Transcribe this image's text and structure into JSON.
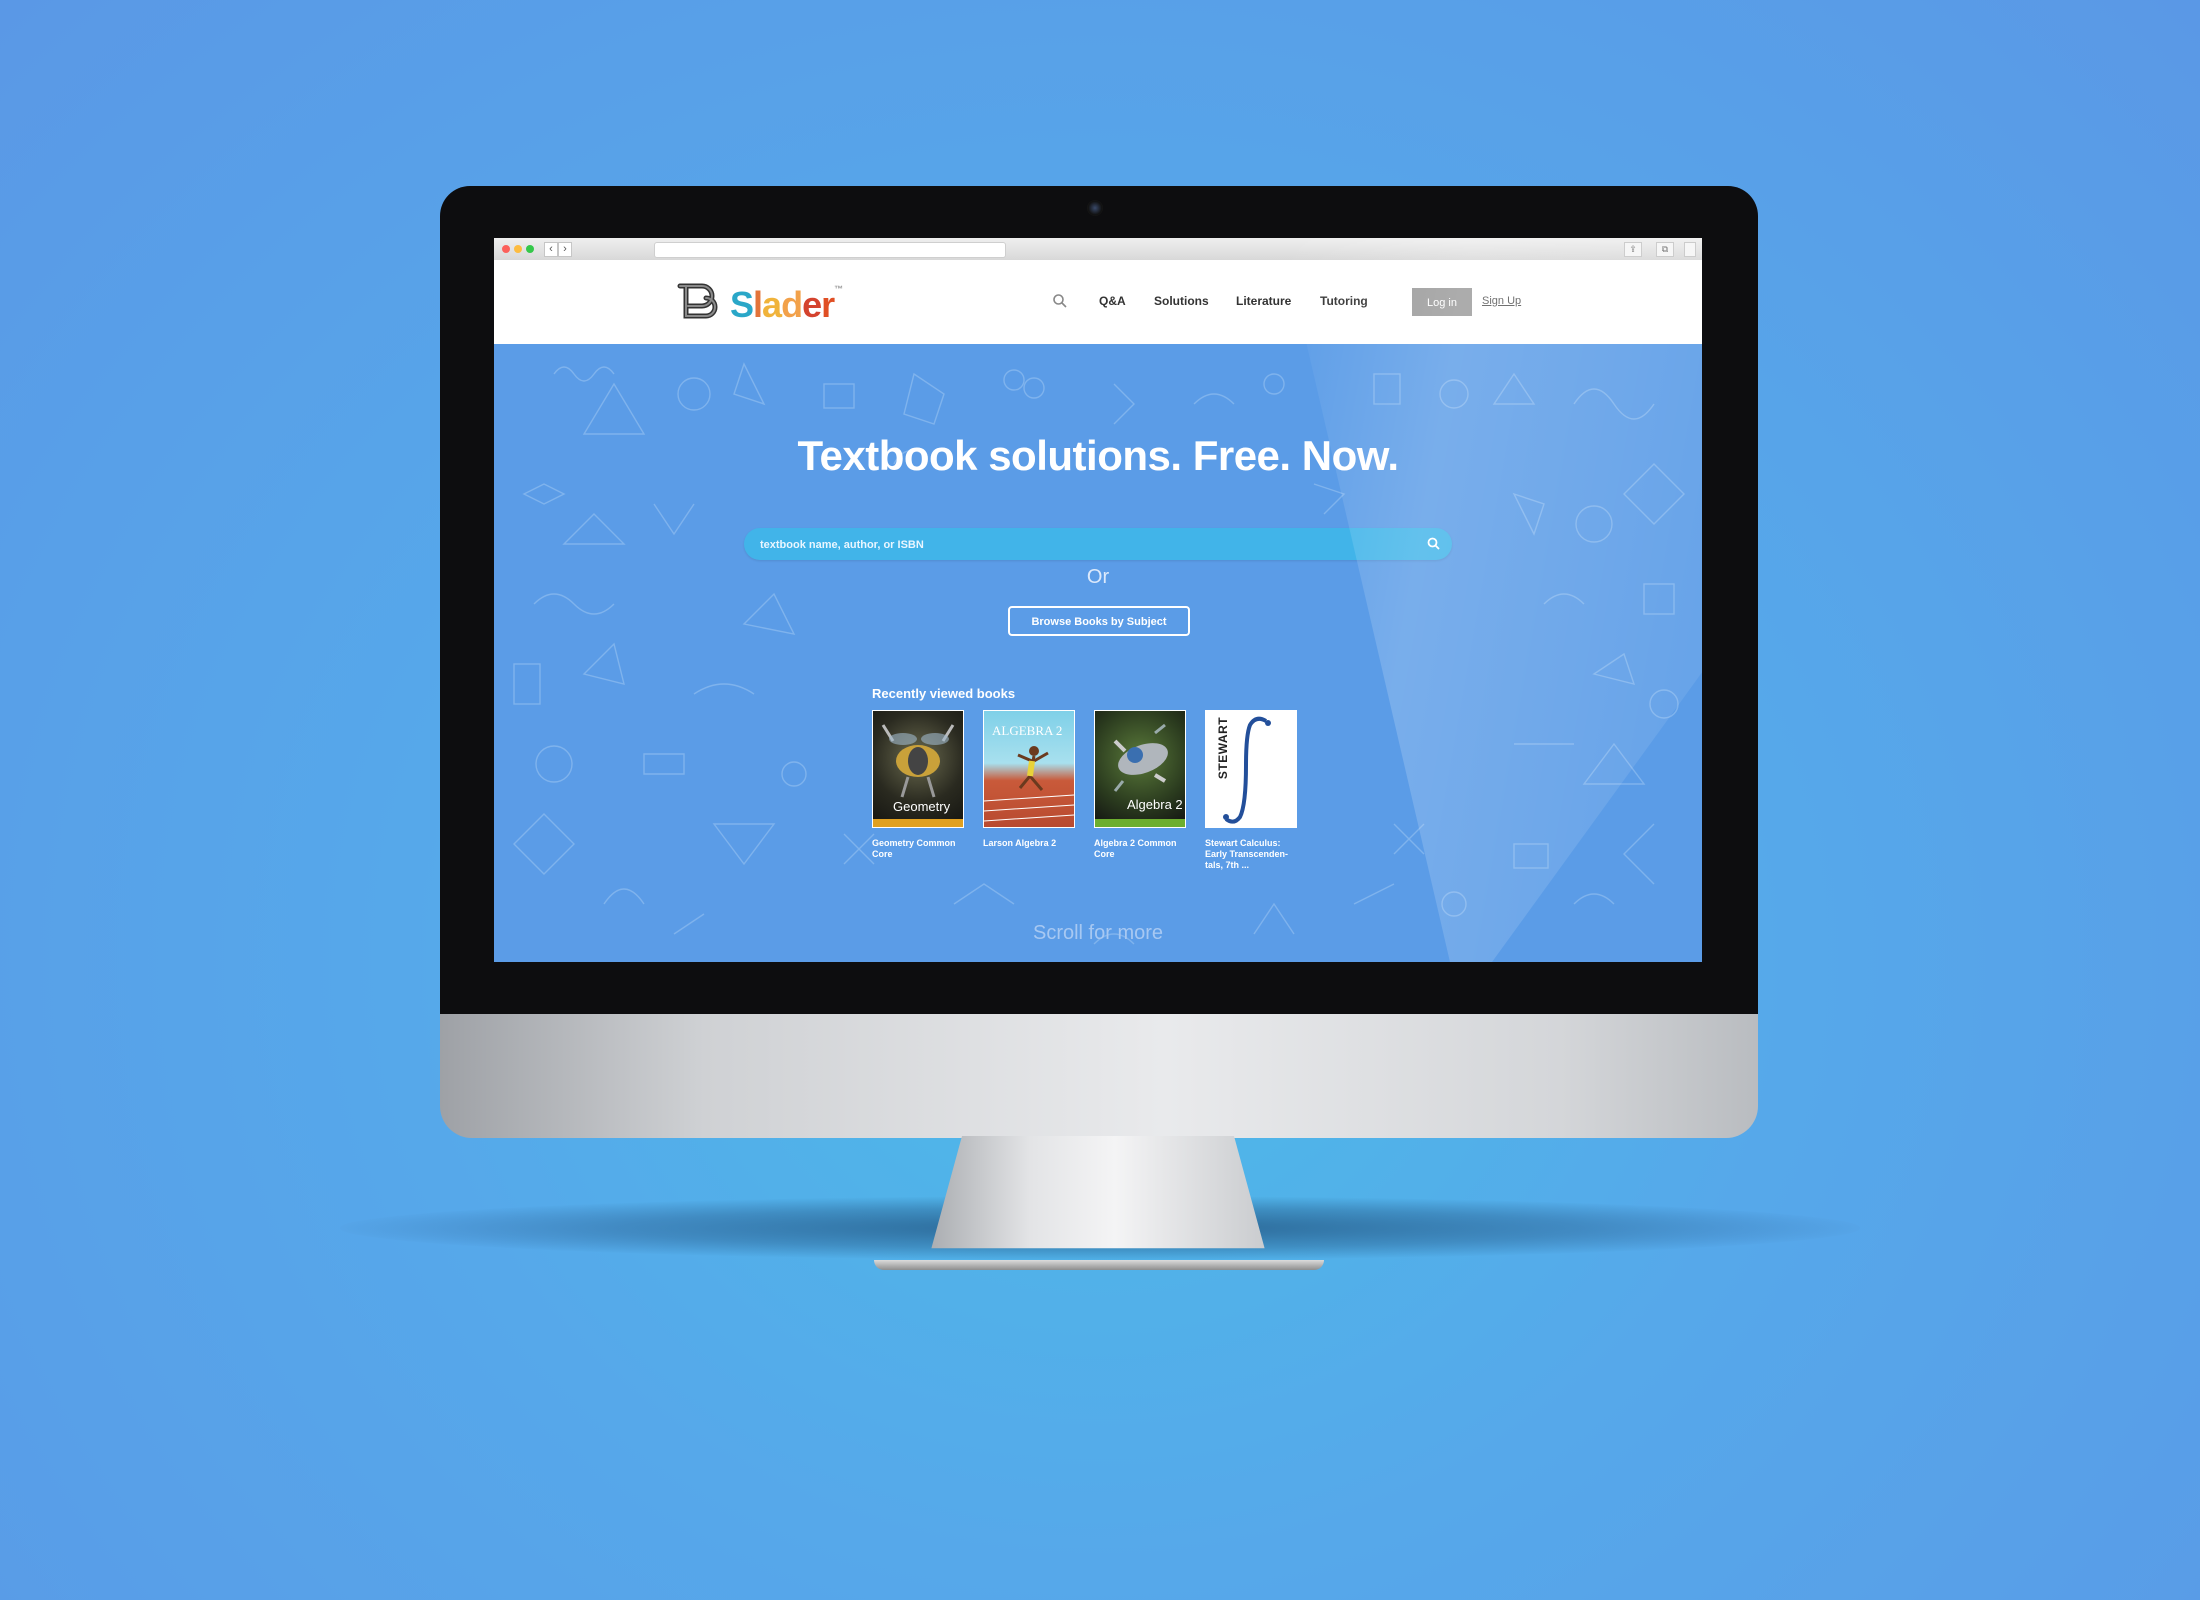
{
  "browser": {
    "back": "‹",
    "forward": "›"
  },
  "header": {
    "logo_text": "Slader",
    "nav": [
      "Q&A",
      "Solutions",
      "Literature",
      "Tutoring"
    ],
    "login_label": "Log in",
    "signup_label": "Sign Up"
  },
  "hero": {
    "title": "Textbook solutions. Free. Now.",
    "search_placeholder": "textbook name, author, or ISBN",
    "or_text": "Or",
    "browse_label": "Browse Books by Subject",
    "recent_title": "Recently viewed books",
    "scroll_label": "Scroll for more"
  },
  "books": [
    {
      "title": "Geometry Common Core",
      "cover_text": "Geometry"
    },
    {
      "title": "Larson Algebra 2",
      "cover_text": "ALGEBRA 2"
    },
    {
      "title": "Algebra 2 Common Core",
      "cover_text": "Algebra 2"
    },
    {
      "title": "Stewart Calculus: Early Transcenden-tals, 7th ...",
      "cover_text": "STEWART"
    }
  ],
  "colors": {
    "hero_bg": "#5b9ce7",
    "search_bg": "#41b4e9",
    "login_bg": "#9a9a9a"
  }
}
